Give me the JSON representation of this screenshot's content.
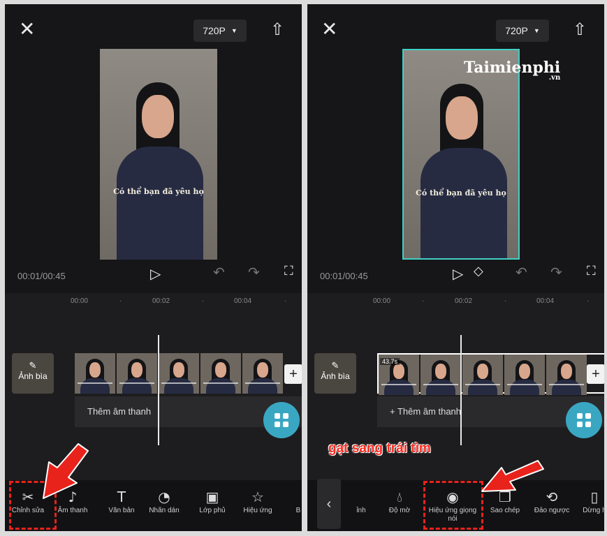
{
  "icons": {
    "close": "close-icon",
    "export": "export-icon",
    "play": "play-icon",
    "undo": "undo-icon",
    "redo": "redo-icon",
    "fullscreen": "fullscreen-icon",
    "keyframe": "keyframe-icon",
    "add": "plus-icon",
    "back": "chevron-left-icon"
  },
  "left": {
    "resolution": "720P",
    "video_caption": "Có thể bạn đã yêu họ",
    "timecode": "00:01/00:45",
    "ruler": [
      "00:00",
      "·",
      "00:02",
      "·",
      "00:04",
      "·"
    ],
    "cover_label": "Ảnh bìa",
    "add_audio": "Thêm âm thanh",
    "tools": [
      "Chỉnh sửa",
      "Âm thanh",
      "Văn bản",
      "Nhãn dán",
      "Lớp phủ",
      "Hiệu ứng",
      "B"
    ]
  },
  "right": {
    "resolution": "720P",
    "video_caption": "Có thể bạn đã yêu họ",
    "timecode": "00:01/00:45",
    "ruler": [
      "00:00",
      "·",
      "00:02",
      "·",
      "00:04",
      "·"
    ],
    "cover_label": "Ảnh bìa",
    "clip_duration": "43.7s",
    "add_audio": "+ Thêm âm thanh",
    "tools": [
      "ỉnh",
      "Độ mờ",
      "Hiệu ứng giọng nói",
      "Sao chép",
      "Đảo ngược",
      "Dừng h"
    ]
  },
  "watermark": {
    "brand": "Taimienphi",
    "domain": ".vn"
  },
  "annotation": "gạt sang trái tìm",
  "colors": {
    "highlight": "#e8231c",
    "accent": "#3aa7c2",
    "selection": "#3fd1c6"
  }
}
